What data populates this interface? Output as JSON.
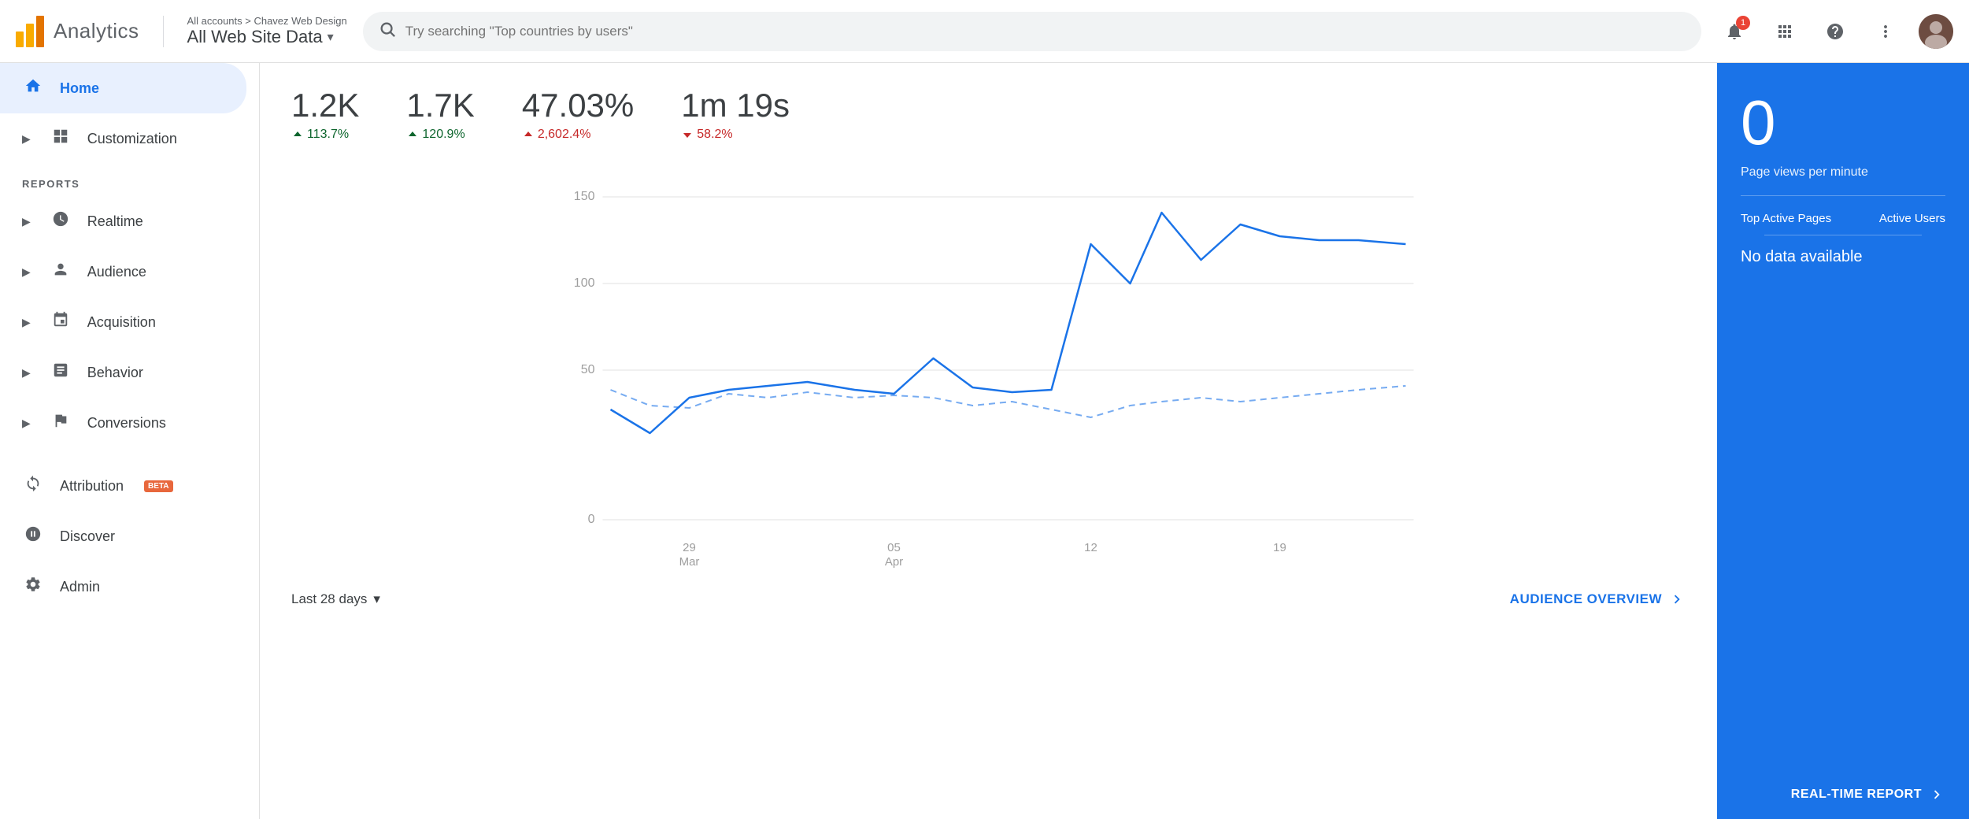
{
  "header": {
    "title": "Analytics",
    "breadcrumb": "All accounts > Chavez Web Design",
    "property": "All Web Site Data",
    "search_placeholder": "Try searching \"Top countries by users\"",
    "notification_count": "1"
  },
  "sidebar": {
    "nav_items": [
      {
        "id": "home",
        "label": "Home",
        "icon": "🏠",
        "active": true
      },
      {
        "id": "customization",
        "label": "Customization",
        "icon": "⊞",
        "active": false
      }
    ],
    "reports_label": "REPORTS",
    "report_items": [
      {
        "id": "realtime",
        "label": "Realtime",
        "icon": "⏱",
        "active": false
      },
      {
        "id": "audience",
        "label": "Audience",
        "icon": "👤",
        "active": false
      },
      {
        "id": "acquisition",
        "label": "Acquisition",
        "icon": "✦",
        "active": false
      },
      {
        "id": "behavior",
        "label": "Behavior",
        "icon": "▤",
        "active": false
      },
      {
        "id": "conversions",
        "label": "Conversions",
        "icon": "⚑",
        "active": false
      }
    ],
    "other_items": [
      {
        "id": "attribution",
        "label": "Attribution",
        "icon": "↻",
        "badge": "BETA",
        "active": false
      },
      {
        "id": "discover",
        "label": "Discover",
        "icon": "💡",
        "active": false
      },
      {
        "id": "admin",
        "label": "Admin",
        "icon": "⚙",
        "active": false
      }
    ]
  },
  "metrics": [
    {
      "id": "sessions",
      "value": "1.2K",
      "change": "113.7%",
      "direction": "up"
    },
    {
      "id": "users",
      "value": "1.7K",
      "change": "120.9%",
      "direction": "up"
    },
    {
      "id": "bounce_rate",
      "value": "47.03%",
      "change": "2,602.4%",
      "direction": "up_red"
    },
    {
      "id": "session_duration",
      "value": "1m 19s",
      "change": "58.2%",
      "direction": "down"
    }
  ],
  "chart": {
    "x_labels": [
      "29\nMar",
      "05\nApr",
      "12",
      "19"
    ],
    "y_labels": [
      "0",
      "50",
      "100",
      "150"
    ],
    "date_range": "Last 28 days",
    "audience_link": "AUDIENCE OVERVIEW"
  },
  "realtime": {
    "count": "0",
    "label": "Page views per minute",
    "top_active_pages": "Top Active Pages",
    "active_users": "Active Users",
    "no_data": "No data available",
    "report_link": "REAL-TIME REPORT"
  }
}
